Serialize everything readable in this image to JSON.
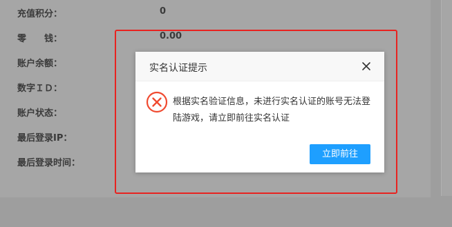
{
  "account_info": {
    "rows": [
      {
        "label": "充值积分：",
        "value": "0"
      },
      {
        "label": "零　　钱：",
        "value": "0.00"
      },
      {
        "label": "账户余额：",
        "value": ""
      },
      {
        "label": "数字ＩＤ：",
        "value": ""
      },
      {
        "label": "账户状态：",
        "value": ""
      },
      {
        "label": "最后登录IP：",
        "value": ""
      },
      {
        "label": "最后登录时间：",
        "value": ""
      }
    ]
  },
  "dialog": {
    "title": "实名认证提示",
    "message": "根据实名验证信息，未进行实名认证的账号无法登陆游戏，请立即前往实名认证",
    "confirm_label": "立即前往",
    "icons": {
      "close": "close-icon",
      "status": "error-circle-icon"
    },
    "colors": {
      "error": "#f04a30",
      "button": "#1e9fff",
      "highlight_border": "#e8221f"
    }
  }
}
